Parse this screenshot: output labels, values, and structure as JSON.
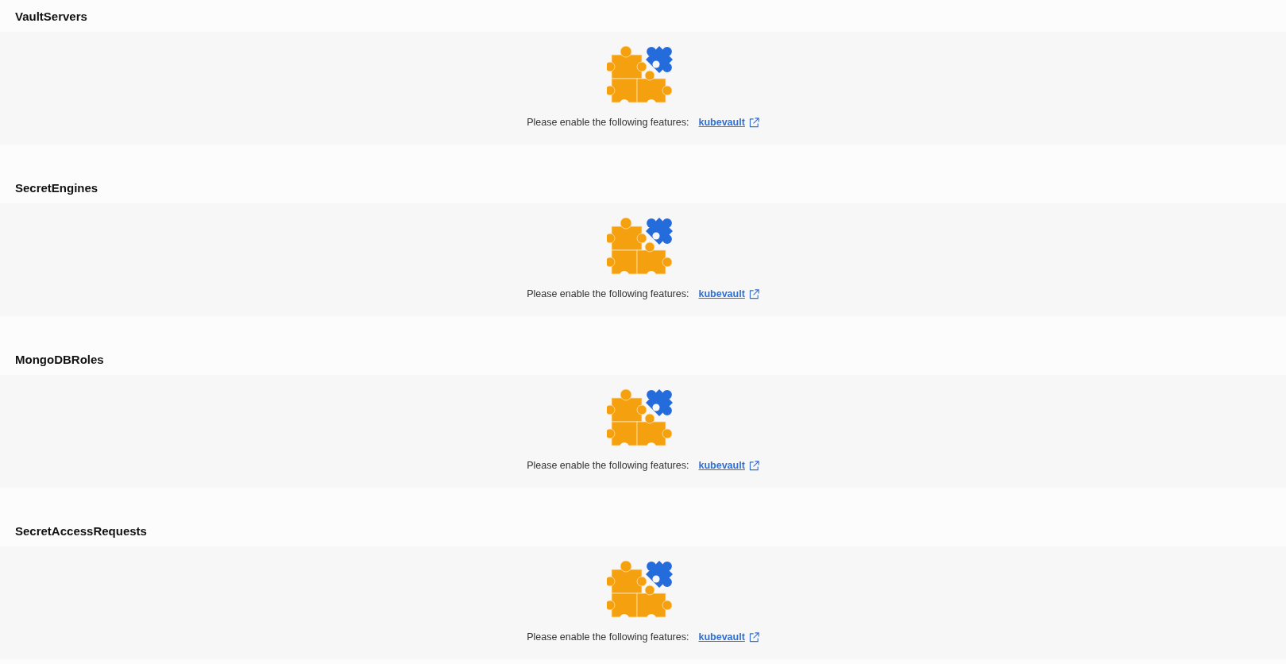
{
  "sections": [
    {
      "title": "VaultServers",
      "message": "Please enable the following features:",
      "link": "kubevault"
    },
    {
      "title": "SecretEngines",
      "message": "Please enable the following features:",
      "link": "kubevault"
    },
    {
      "title": "MongoDBRoles",
      "message": "Please enable the following features:",
      "link": "kubevault"
    },
    {
      "title": "SecretAccessRequests",
      "message": "Please enable the following features:",
      "link": "kubevault"
    }
  ]
}
